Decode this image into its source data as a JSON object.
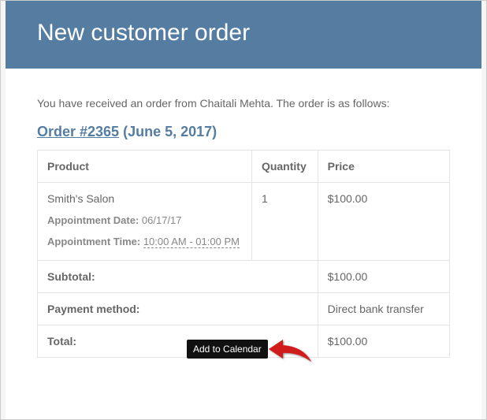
{
  "header": {
    "title": "New customer order"
  },
  "intro": "You have received an order from Chaitali Mehta. The order is as follows:",
  "order": {
    "link_text": "Order #2365",
    "date_paren": "(June 5, 2017)"
  },
  "table": {
    "head": {
      "product": "Product",
      "quantity": "Quantity",
      "price": "Price"
    },
    "item": {
      "name": "Smith's Salon",
      "appt_date_label": "Appointment Date:",
      "appt_date": "06/17/17",
      "appt_time_label": "Appointment Time:",
      "appt_time": "10:00 AM - 01:00 PM",
      "quantity": "1",
      "price": "$100.00"
    },
    "subtotal_label": "Subtotal:",
    "subtotal_value": "$100.00",
    "payment_label": "Payment method:",
    "payment_value": "Direct bank transfer",
    "total_label": "Total:",
    "total_value": "$100.00"
  },
  "tooltip": "Add to Calendar"
}
